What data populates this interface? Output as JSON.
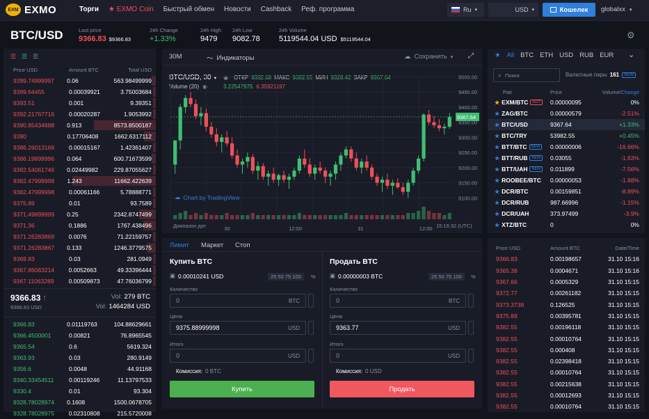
{
  "nav": {
    "logo": "EXMO",
    "items": [
      "Торги",
      "EXMO Coin",
      "Быстрый обмен",
      "Новости",
      "Cashback",
      "Реф. программа"
    ],
    "lang": "Ru",
    "currency": "USD",
    "wallet": "Кошелек",
    "user": "globalxx"
  },
  "ticker": {
    "pair": "BTC/USD",
    "last_price_label": "Last price",
    "last_price": "9366.83",
    "last_price_sub": "$9366.83",
    "change_label": "24h Change",
    "change": "+1.33%",
    "high_label": "24h High",
    "high": "9479",
    "low_label": "24h Low",
    "low": "9082.78",
    "volume_label": "24h Volume",
    "volume": "5119544.04 USD",
    "volume_sub": "$5119544.04"
  },
  "orderbook": {
    "headers": [
      "Price USD",
      "Amount BTC",
      "Total USD"
    ],
    "asks": [
      [
        "9399.74999997",
        "0.06",
        "563.98499999"
      ],
      [
        "9399.64455",
        "0.00039921",
        "3.75003684"
      ],
      [
        "9393.51",
        "0.001",
        "9.39351"
      ],
      [
        "9392.21767716",
        "0.00020287",
        "1.9053992"
      ],
      [
        "9390.85434688",
        "0.913",
        "8573.8500187"
      ],
      [
        "9390",
        "0.17706408",
        "1662.6317112"
      ],
      [
        "9386.26013169",
        "0.00015167",
        "1.42361407"
      ],
      [
        "9386.19899996",
        "0.064",
        "600.71673599"
      ],
      [
        "9382.54061746",
        "0.02449982",
        "229.87055627"
      ],
      [
        "9382.47999999",
        "1.243",
        "11662.422639"
      ],
      [
        "9382.47999998",
        "0.00061166",
        "5.78888771"
      ],
      [
        "9375.89",
        "0.01",
        "93.7589"
      ],
      [
        "9371.49899999",
        "0.25",
        "2342.8747499"
      ],
      [
        "9371.36",
        "0.1886",
        "1767.438496"
      ],
      [
        "9371.26283869",
        "0.0076",
        "71.22159757"
      ],
      [
        "9371.26283867",
        "0.133",
        "1246.3779575"
      ],
      [
        "9369.83",
        "0.03",
        "281.0949"
      ],
      [
        "9367.86063214",
        "0.0052663",
        "49.33396444"
      ],
      [
        "9367.11063289",
        "0.00509873",
        "47.76036799"
      ]
    ],
    "ask_fill": [
      0.05,
      0.01,
      0.01,
      0.01,
      0.74,
      0.14,
      0.01,
      0.05,
      0.02,
      1.0,
      0.01,
      0.01,
      0.2,
      0.15,
      0.01,
      0.11,
      0.02,
      0.01,
      0.01
    ],
    "mid_price": "9366.83",
    "mid_arrow": "↑",
    "mid_sub": "9366.83 USD",
    "vol_btc_label": "Vol:",
    "vol_btc": "279 BTC",
    "vol_usd_label": "Vol:",
    "vol_usd": "1464284 USD",
    "bids": [
      [
        "9366.83",
        "0.01119763",
        "104.88629661"
      ],
      [
        "9366.4500001",
        "0.00821",
        "76.8965545"
      ],
      [
        "9365.54",
        "0.6",
        "5619.324"
      ],
      [
        "9363.93",
        "0.03",
        "280.9149"
      ],
      [
        "9356.6",
        "0.0048",
        "44.91168"
      ],
      [
        "9340.33454511",
        "0.00119246",
        "11.13797533"
      ],
      [
        "9330.4",
        "0.01",
        "93.304"
      ],
      [
        "9328.78028974",
        "0.1608",
        "1500.0678705"
      ],
      [
        "9328.78028975",
        "0.02310808",
        "215.5720008"
      ]
    ]
  },
  "chart": {
    "timeframe": "30M",
    "indicators": "Индикаторы",
    "save": "Сохранить",
    "symbol": "BTC/USD, 30",
    "o_label": "ОТКР",
    "o": "9332.68",
    "h_label": "МАКС",
    "h": "9382.55",
    "l_label": "МИН",
    "l": "9328.42",
    "c_label": "ЗАКР",
    "c": "9367.64",
    "vol_label": "Volume (20)",
    "vol1": "3.22547975",
    "vol2": "6.35921197",
    "y_ticks": [
      "9500.00",
      "9450.00",
      "9400.00",
      "9350.00",
      "9300.00",
      "9250.00",
      "9200.00",
      "9150.00",
      "9100.00"
    ],
    "current": "9367.64",
    "x_ticks": [
      "30",
      "12:00",
      "31",
      "12:00"
    ],
    "range_label": "Диапазон дат",
    "clock": "15:16:32 (UTC)",
    "attribution": "Chart by TradingView"
  },
  "chart_data": {
    "type": "candlestick",
    "ylim": [
      9080,
      9510
    ],
    "candles": [
      [
        9210,
        9290,
        9180,
        9290
      ],
      [
        9290,
        9410,
        9260,
        9400
      ],
      [
        9400,
        9440,
        9380,
        9430
      ],
      [
        9430,
        9450,
        9400,
        9410
      ],
      [
        9410,
        9425,
        9360,
        9370
      ],
      [
        9370,
        9400,
        9340,
        9380
      ],
      [
        9380,
        9395,
        9320,
        9335
      ],
      [
        9335,
        9350,
        9300,
        9310
      ],
      [
        9310,
        9330,
        9270,
        9285
      ],
      [
        9285,
        9310,
        9250,
        9300
      ],
      [
        9300,
        9320,
        9270,
        9280
      ],
      [
        9280,
        9300,
        9230,
        9240
      ],
      [
        9240,
        9260,
        9200,
        9210
      ],
      [
        9210,
        9230,
        9180,
        9220
      ],
      [
        9220,
        9250,
        9200,
        9235
      ],
      [
        9235,
        9245,
        9180,
        9190
      ],
      [
        9190,
        9220,
        9160,
        9205
      ],
      [
        9205,
        9215,
        9160,
        9170
      ],
      [
        9170,
        9190,
        9140,
        9180
      ],
      [
        9180,
        9200,
        9150,
        9160
      ],
      [
        9160,
        9180,
        9140,
        9175
      ],
      [
        9175,
        9190,
        9150,
        9160
      ],
      [
        9160,
        9180,
        9130,
        9170
      ],
      [
        9170,
        9200,
        9160,
        9190
      ],
      [
        9190,
        9240,
        9180,
        9230
      ],
      [
        9230,
        9260,
        9200,
        9210
      ],
      [
        9210,
        9230,
        9170,
        9180
      ],
      [
        9180,
        9210,
        9160,
        9200
      ],
      [
        9200,
        9220,
        9180,
        9190
      ],
      [
        9190,
        9200,
        9150,
        9170
      ],
      [
        9170,
        9190,
        9140,
        9180
      ],
      [
        9180,
        9220,
        9160,
        9210
      ],
      [
        9210,
        9250,
        9190,
        9240
      ],
      [
        9240,
        9270,
        9230,
        9260
      ],
      [
        9260,
        9270,
        9220,
        9230
      ],
      [
        9230,
        9250,
        9190,
        9200
      ],
      [
        9200,
        9230,
        9180,
        9220
      ],
      [
        9220,
        9240,
        9190,
        9200
      ],
      [
        9200,
        9210,
        9160,
        9170
      ],
      [
        9170,
        9180,
        9140,
        9150
      ],
      [
        9150,
        9170,
        9120,
        9160
      ],
      [
        9160,
        9180,
        9130,
        9140
      ],
      [
        9140,
        9160,
        9110,
        9150
      ],
      [
        9150,
        9165,
        9130,
        9135
      ],
      [
        9135,
        9150,
        9110,
        9120
      ],
      [
        9120,
        9160,
        9100,
        9150
      ],
      [
        9150,
        9200,
        9140,
        9190
      ],
      [
        9190,
        9240,
        9180,
        9230
      ],
      [
        9230,
        9380,
        9220,
        9375
      ],
      [
        9375,
        9390,
        9340,
        9350
      ],
      [
        9350,
        9370,
        9330,
        9340
      ],
      [
        9340,
        9360,
        9320,
        9330
      ],
      [
        9330,
        9345,
        9310,
        9335
      ],
      [
        9335,
        9380,
        9328,
        9367.64
      ]
    ],
    "volumes": [
      2,
      3,
      4,
      2,
      3,
      2,
      3,
      2,
      2,
      2,
      3,
      2,
      2,
      2,
      2,
      3,
      2,
      2,
      2,
      2,
      2,
      2,
      2,
      2,
      3,
      2,
      2,
      2,
      2,
      2,
      2,
      2,
      2,
      3,
      2,
      2,
      2,
      2,
      2,
      2,
      2,
      2,
      2,
      2,
      2,
      3,
      3,
      4,
      6,
      4,
      3,
      3,
      2,
      3
    ]
  },
  "order_form": {
    "tabs": [
      "Лимит",
      "Маркет",
      "Стоп"
    ],
    "buy": {
      "title": "Купить BTC",
      "balance": "0.00010241 USD",
      "pcts": "25 50 75 100",
      "pct_sign": "%",
      "qty_label": "Количество",
      "qty": "0",
      "qty_unit": "BTC",
      "price_label": "Цена",
      "price": "9375.88999998",
      "price_unit": "USD",
      "total_label": "Итого",
      "total": "0",
      "total_unit": "USD",
      "fee_label": "Комиссия:",
      "fee": "0 BTC",
      "button": "Купить"
    },
    "sell": {
      "title": "Продать BTC",
      "balance": "0.00000003 BTC",
      "pcts": "25 50 75 100",
      "pct_sign": "%",
      "qty_label": "Количество",
      "qty": "0",
      "qty_unit": "BTC",
      "price_label": "Цена",
      "price": "9363.77",
      "price_unit": "USD",
      "total_label": "Итого",
      "total": "0",
      "total_unit": "USD",
      "fee_label": "Комиссия:",
      "fee": "0 USD",
      "button": "Продать"
    }
  },
  "pairs": {
    "tabs": [
      "All",
      "BTC",
      "ETH",
      "USD",
      "RUB",
      "EUR"
    ],
    "search_placeholder": "Поиск",
    "count_label": "Валютные пары",
    "count": "161",
    "new_badge": "NEW",
    "headers": [
      "Pair",
      "Price",
      "Volume/",
      "Change"
    ],
    "rows": [
      {
        "pair": "EXM/BTC",
        "badge": "HOT",
        "price": "0.00000095",
        "change": "0%",
        "dir": "flat"
      },
      {
        "pair": "ZAG/BTC",
        "badge": "",
        "price": "0.00000579",
        "change": "-2.51%",
        "dir": "down"
      },
      {
        "pair": "BTC/USD",
        "badge": "",
        "price": "9367.64",
        "change": "+1.33%",
        "dir": "up"
      },
      {
        "pair": "BTC/TRY",
        "badge": "",
        "price": "53982.55",
        "change": "+0.45%",
        "dir": "up"
      },
      {
        "pair": "BTT/BTC",
        "badge": "NEW",
        "price": "0.00000006",
        "change": "-16.66%",
        "dir": "down"
      },
      {
        "pair": "BTT/RUB",
        "badge": "NEW",
        "price": "0.03055",
        "change": "-1.63%",
        "dir": "down"
      },
      {
        "pair": "BTT/UAH",
        "badge": "NEW",
        "price": "0.011899",
        "change": "-7.56%",
        "dir": "down"
      },
      {
        "pair": "ROOBEE/BTC",
        "badge": "",
        "price": "0.00000053",
        "change": "-1.88%",
        "dir": "down"
      },
      {
        "pair": "DCR/BTC",
        "badge": "",
        "price": "0.00159851",
        "change": "-8.89%",
        "dir": "down"
      },
      {
        "pair": "DCR/RUB",
        "badge": "",
        "price": "987.66996",
        "change": "-1.15%",
        "dir": "down"
      },
      {
        "pair": "DCR/UAH",
        "badge": "",
        "price": "373.97499",
        "change": "-3.9%",
        "dir": "down"
      },
      {
        "pair": "XTZ/BTC",
        "badge": "",
        "price": "0",
        "change": "0%",
        "dir": "flat"
      }
    ]
  },
  "trades": {
    "headers": [
      "Price USD",
      "Amount BTC",
      "Date/Time"
    ],
    "rows": [
      {
        "price": "9366.83",
        "amount": "0.00198657",
        "time": "31.10 15:16",
        "side": "sell"
      },
      {
        "price": "9365.38",
        "amount": "0.0004671",
        "time": "31.10 15:16",
        "side": "sell"
      },
      {
        "price": "9367.66",
        "amount": "0.0005329",
        "time": "31.10 15:15",
        "side": "sell"
      },
      {
        "price": "9372.77",
        "amount": "0.00261182",
        "time": "31.10 15:15",
        "side": "sell"
      },
      {
        "price": "9373.3738",
        "amount": "0.126525",
        "time": "31.10 15:15",
        "side": "sell"
      },
      {
        "price": "9375.89",
        "amount": "0.00395781",
        "time": "31.10 15:15",
        "side": "sell"
      },
      {
        "price": "9382.55",
        "amount": "0.00196118",
        "time": "31.10 15:15",
        "side": "sell"
      },
      {
        "price": "9382.55",
        "amount": "0.00010764",
        "time": "31.10 15:15",
        "side": "sell"
      },
      {
        "price": "9382.55",
        "amount": "0.000408",
        "time": "31.10 15:15",
        "side": "sell"
      },
      {
        "price": "9382.55",
        "amount": "0.02398418",
        "time": "31.10 15:15",
        "side": "sell"
      },
      {
        "price": "9382.55",
        "amount": "0.00010764",
        "time": "31.10 15:15",
        "side": "sell"
      },
      {
        "price": "9382.55",
        "amount": "0.00215638",
        "time": "31.10 15:15",
        "side": "sell"
      },
      {
        "price": "9382.55",
        "amount": "0.00012693",
        "time": "31.10 15:15",
        "side": "sell"
      },
      {
        "price": "9382.55",
        "amount": "0.00010764",
        "time": "31.10 15:15",
        "side": "sell"
      }
    ]
  },
  "colors": {
    "bg": "#12141c",
    "panel": "#191c26",
    "red": "#ef4f5a",
    "green": "#3fbf72",
    "accent": "#2f7fdc",
    "buy_button": "#4caf50",
    "sell_button": "#f0575f"
  }
}
